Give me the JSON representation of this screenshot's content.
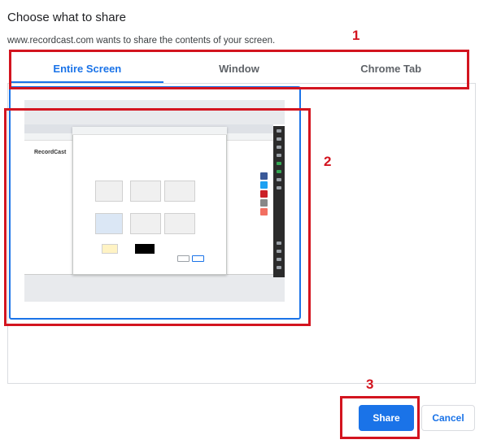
{
  "dialog": {
    "title": "Choose what to share",
    "subtitle": "www.recordcast.com wants to share the contents of your screen."
  },
  "tabs": [
    {
      "label": "Entire Screen",
      "active": true
    },
    {
      "label": "Window",
      "active": false
    },
    {
      "label": "Chrome Tab",
      "active": false
    }
  ],
  "preview": {
    "logo_text": "RecordCast"
  },
  "buttons": {
    "share_label": "Share",
    "cancel_label": "Cancel"
  },
  "annotations": {
    "marker_1": "1",
    "marker_2": "2",
    "marker_3": "3",
    "color": "#d3141f"
  },
  "colors": {
    "accent": "#1a73e8"
  }
}
